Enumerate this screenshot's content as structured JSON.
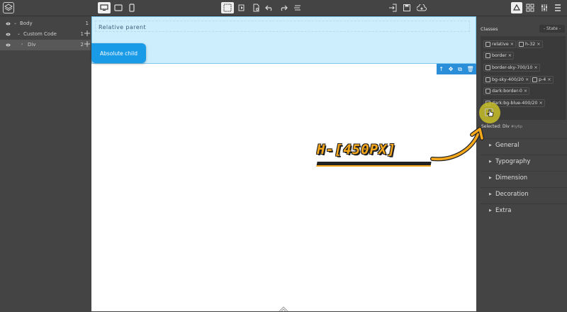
{
  "layers": [
    {
      "name": "Body",
      "count": "1",
      "selected": false
    },
    {
      "name": "Custom Code",
      "count": "1",
      "selected": false
    },
    {
      "name": "Div",
      "count": "2",
      "selected": true
    }
  ],
  "canvas": {
    "relative_parent_label": "Relative parent",
    "absolute_child_label": "Absolute child"
  },
  "right_panel": {
    "classes_label": "Classes",
    "state_label": "- State -",
    "classes": [
      "relative",
      "h-32",
      "border",
      "border-sky-700/10",
      "bg-sky-400/20",
      "p-4",
      "dark:border-0",
      "dark:bg-blue-400/20"
    ],
    "selected_label": "Selected:",
    "selected_name": "Div",
    "selected_id": "#iy6p",
    "sectors": [
      "General",
      "Typography",
      "Dimension",
      "Decoration",
      "Extra"
    ]
  },
  "annotation": {
    "text": "H-[450PX]"
  },
  "colors": {
    "accent_blue": "#1a9be8",
    "annotation_orange": "#f7a81b",
    "panel_bg": "#444444"
  }
}
